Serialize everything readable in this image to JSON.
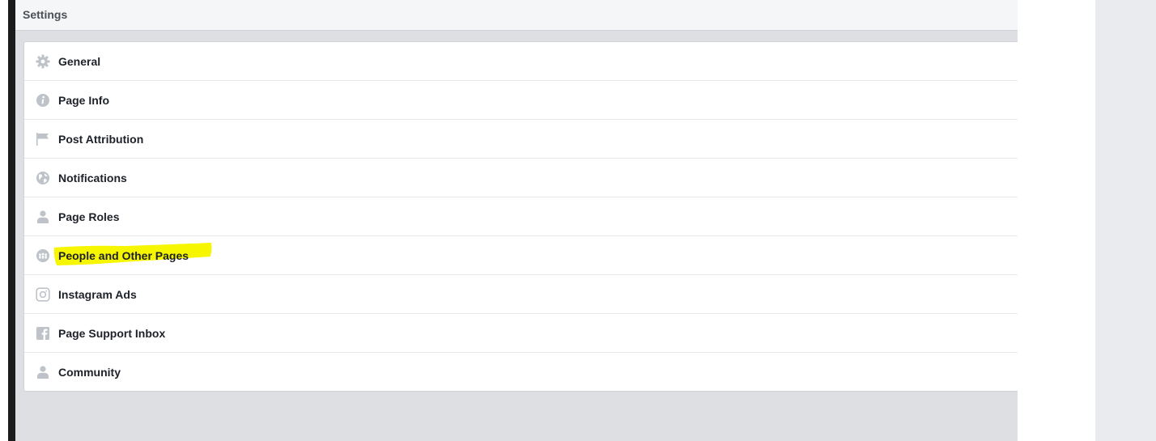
{
  "header": {
    "title": "Settings"
  },
  "menu": {
    "items": [
      {
        "label": "General",
        "icon": "gear-icon"
      },
      {
        "label": "Page Info",
        "icon": "info-icon"
      },
      {
        "label": "Post Attribution",
        "icon": "flag-icon"
      },
      {
        "label": "Notifications",
        "icon": "globe-icon"
      },
      {
        "label": "Page Roles",
        "icon": "person-icon"
      },
      {
        "label": "People and Other Pages",
        "icon": "people-icon",
        "highlighted": true
      },
      {
        "label": "Instagram Ads",
        "icon": "instagram-icon"
      },
      {
        "label": "Page Support Inbox",
        "icon": "facebook-icon"
      },
      {
        "label": "Community",
        "icon": "person-icon"
      }
    ]
  },
  "colors": {
    "highlight": "#f6f600",
    "icon": "#bec3c9",
    "text": "#1d2129",
    "background": "#dddfe2"
  }
}
